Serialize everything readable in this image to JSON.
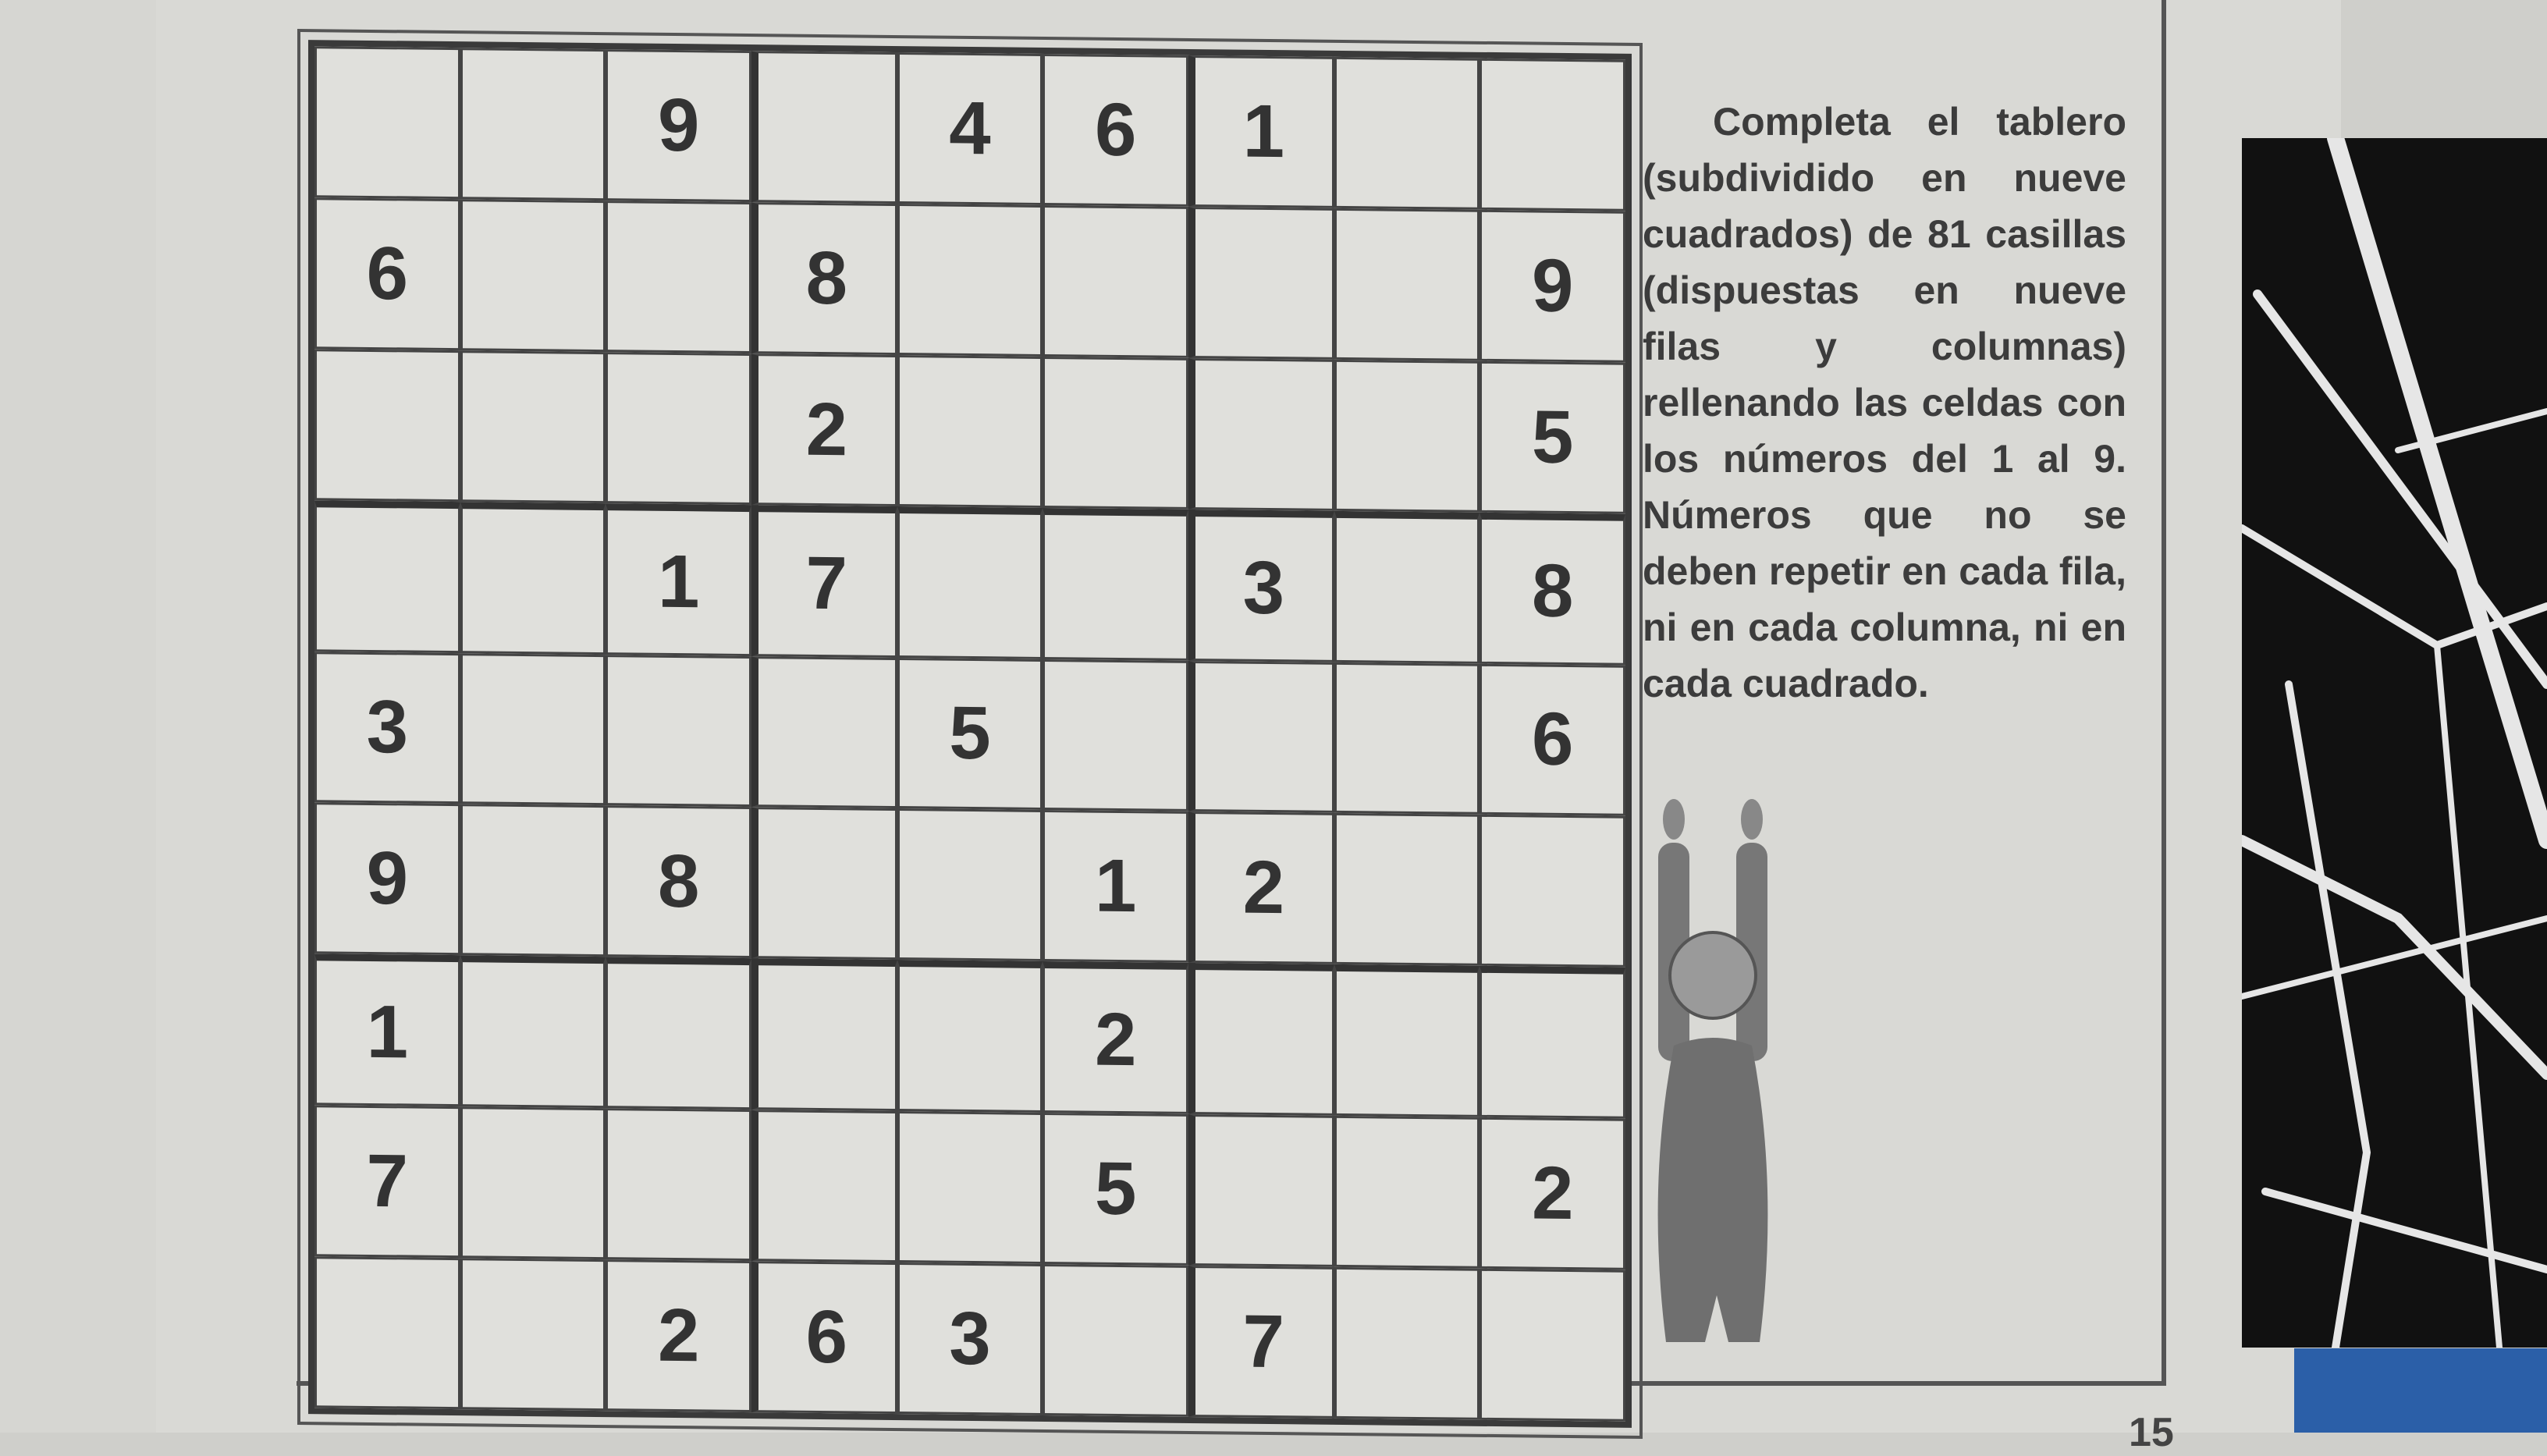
{
  "puzzle": {
    "rows": [
      [
        "",
        "",
        "9",
        "",
        "4",
        "6",
        "1",
        "",
        ""
      ],
      [
        "6",
        "",
        "",
        "8",
        "",
        "",
        "",
        "",
        "9"
      ],
      [
        "",
        "",
        "",
        "2",
        "",
        "",
        "",
        "",
        "5"
      ],
      [
        "",
        "",
        "1",
        "7",
        "",
        "",
        "3",
        "",
        "8"
      ],
      [
        "3",
        "",
        "",
        "",
        "5",
        "",
        "",
        "",
        "6"
      ],
      [
        "9",
        "",
        "8",
        "",
        "",
        "1",
        "2",
        "",
        ""
      ],
      [
        "1",
        "",
        "",
        "",
        "",
        "2",
        "",
        "",
        ""
      ],
      [
        "7",
        "",
        "",
        "",
        "",
        "5",
        "",
        "",
        "2"
      ],
      [
        "",
        "",
        "2",
        "6",
        "3",
        "",
        "7",
        "",
        ""
      ]
    ]
  },
  "instructions": "Completa el tablero (subdividido en nueve cuadrados) de 81 casillas (dispuestas en nueve filas y columnas) rellenando las celdas con los números del 1 al 9. Números que no se deben repetir en cada fila, ni en cada columna, ni en cada cuadrado.",
  "page_number": "15"
}
